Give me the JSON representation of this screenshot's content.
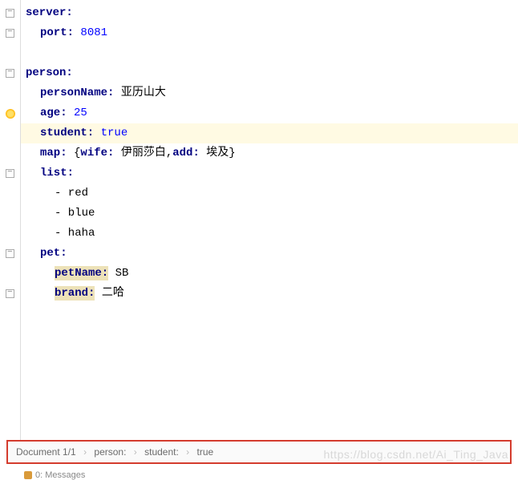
{
  "code": {
    "server": {
      "key": "server:",
      "port_key": "port:",
      "port_val": "8081"
    },
    "person": {
      "key": "person:",
      "personName_key": "personName:",
      "personName_val": "亚历山大",
      "age_key": "age:",
      "age_val": "25",
      "student_key": "student:",
      "student_val": "true",
      "map_key": "map:",
      "map_open": "{",
      "map_wife_key": "wife:",
      "map_wife_val": "伊丽莎白,",
      "map_add_key": "add:",
      "map_add_val": "埃及",
      "map_close": "}",
      "list_key": "list:",
      "list_items": [
        "- red",
        "- blue",
        "- haha"
      ],
      "pet_key": "pet:",
      "petName_key": "petName:",
      "petName_val": "SB",
      "brand_key": "brand:",
      "brand_val": "二哈"
    }
  },
  "breadcrumb": {
    "doc": "Document 1/1",
    "p1": "person:",
    "p2": "student:",
    "p3": "true"
  },
  "watermark": "https://blog.csdn.net/Ai_Ting_Java",
  "bottom_tab": "0: Messages"
}
